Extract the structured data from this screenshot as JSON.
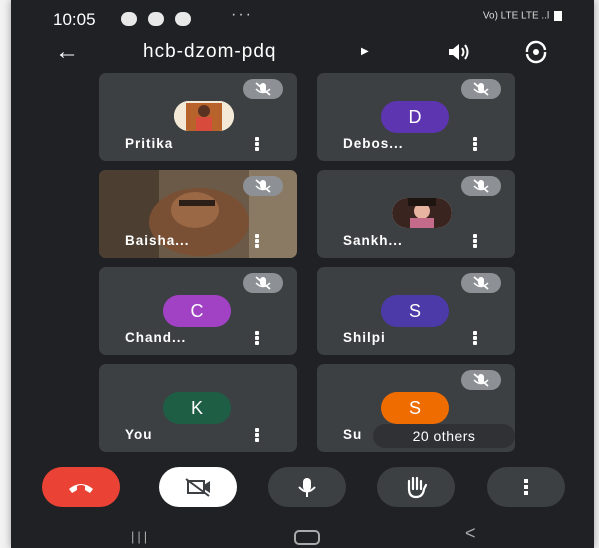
{
  "status_bar": {
    "time": "10:05",
    "more": "···",
    "network_right": "Vo) LTE  LTE ..l"
  },
  "header": {
    "meeting_code": "hcb-dzom-pdq"
  },
  "participants": [
    {
      "name": "Pritika",
      "avatar": "photo",
      "mic_muted": true
    },
    {
      "name": "Debos...",
      "avatar_letter": "D",
      "avatar_color": "#5e35b1",
      "mic_muted": true
    },
    {
      "name": "Baisha...",
      "avatar": "video",
      "mic_muted": true
    },
    {
      "name": "Sankh...",
      "avatar": "photo",
      "mic_muted": true
    },
    {
      "name": "Chand...",
      "avatar_letter": "C",
      "avatar_color": "#a142c5",
      "mic_muted": true
    },
    {
      "name": "Shilpi",
      "avatar_letter": "S",
      "avatar_color": "#4b3aa8",
      "mic_muted": true
    },
    {
      "name": "You",
      "avatar_letter": "K",
      "avatar_color": "#1e5e45",
      "mic_muted": false
    },
    {
      "name": "Su",
      "avatar_letter": "S",
      "avatar_color": "#ef6c00",
      "mic_muted": true
    }
  ],
  "others_chip": "20 others",
  "colors": {
    "end_call": "#ea4335",
    "camera_btn": "#ffffff",
    "tile_bg": "#3c4043",
    "background": "#202124"
  },
  "controls": [
    "end-call",
    "camera-off",
    "microphone",
    "raise-hand",
    "more-options"
  ]
}
